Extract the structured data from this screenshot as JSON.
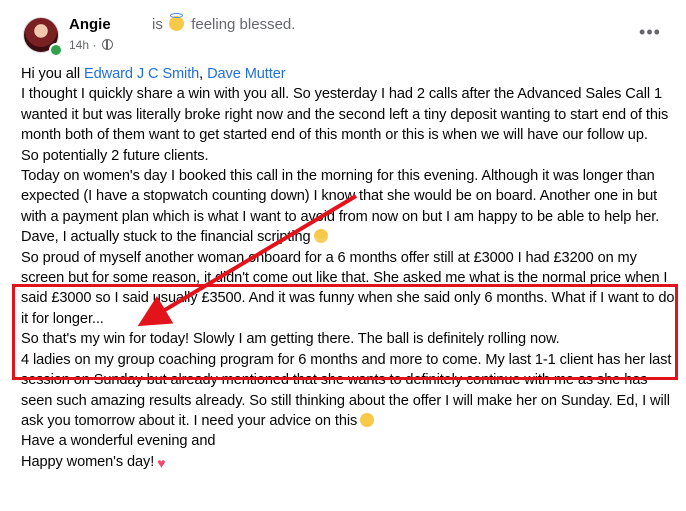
{
  "post": {
    "author": "Angie",
    "status_prefix": "is",
    "status_text": "feeling blessed.",
    "status_emoji": "innocent-face-icon",
    "timestamp": "14h",
    "visibility_icon": "globe-icon",
    "more_label": "•••",
    "body": {
      "line1_text": "Hi you all ",
      "mention1": "Edward J C Smith",
      "mention_sep": ", ",
      "mention2": "Dave Mutter",
      "para1": "I thought I quickly share a win with you all. So yesterday I had 2 calls after the Advanced Sales Call 1 wanted it but was literally broke right now and the second left a tiny deposit wanting to start end of this month both of them want to get started end of this month or this is when we will have our follow up.",
      "para2": "So potentially 2 future clients.",
      "para3": "Today on women's day I booked this call in the morning for this evening. Although it was longer than expected (I have a stopwatch counting down) I know that she would be on board. Another one in but with a payment plan which is what I want to avoid from now on but I am happy to be able to help her.",
      "para4": "Dave, I actually stuck to the financial scripting",
      "para4_emoji": "grinning-face-icon",
      "para5": "So proud of myself another woman onboard for a 6 months offer still at £3000 I had £3200 on my screen but for some reason, it didn't come out like that. She asked me what is the normal price when I said £3000 so I said usually £3500. And it was funny when she said only 6 months. What if I want to do it for longer...",
      "para6": "So that's my win for today! Slowly I am getting there. The ball is definitely rolling now.",
      "para7": "4 ladies on my group coaching program for 6 months and more to come. My last 1-1 client has her last session on Sunday but already mentioned that she wants to definitely continue with me as she has seen such amazing results already. So still thinking about the offer I will make her on Sunday. Ed, I will ask you tomorrow about it. I need your advice on this",
      "para7_emoji": "face-blowing-kiss-icon",
      "para8": "Have a wonderful evening and",
      "para9": "Happy women's day!",
      "para9_emoji": "heart-icon"
    }
  },
  "annotation": {
    "color": "#e3131b"
  }
}
